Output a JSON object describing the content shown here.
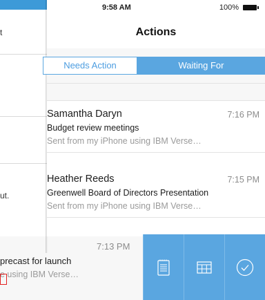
{
  "behind": {
    "text_top": "t",
    "text_middle": "ut.",
    "row": {
      "time": "7:13 PM",
      "subject": "precast for launch",
      "preview": "e using IBM Verse…"
    }
  },
  "status_bar": {
    "time": "9:58 AM",
    "battery": "100%"
  },
  "nav": {
    "title": "Actions"
  },
  "segments": {
    "needs_action": "Needs Action",
    "waiting_for": "Waiting For",
    "selected": "Waiting For"
  },
  "messages": [
    {
      "sender": "Samantha Daryn",
      "time": "7:16 PM",
      "subject": "Budget review meetings",
      "preview": "Sent from my iPhone using IBM Verse…"
    },
    {
      "sender": "Heather Reeds",
      "time": "7:15 PM",
      "subject": "Greenwell Board of Directors Presentation",
      "preview": "Sent from my iPhone using IBM Verse…"
    }
  ],
  "swipe_actions": [
    "notepad-icon",
    "calendar-icon",
    "checkmark-icon"
  ],
  "colors": {
    "accent": "#5aa6e0",
    "header_blue": "#3d9ad8",
    "background_gray": "#f7f7f7",
    "mark_red": "#e32020"
  }
}
